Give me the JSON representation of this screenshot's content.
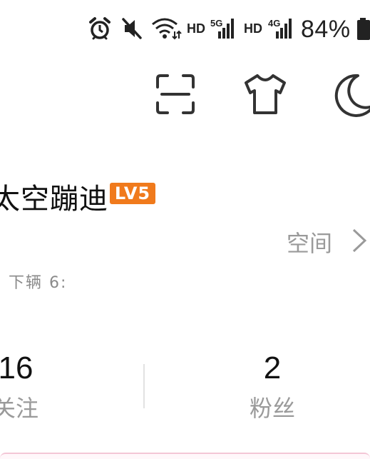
{
  "status_bar": {
    "icons": [
      "alarm-icon",
      "mute-icon",
      "wifi-icon",
      "signal-5g-icon",
      "signal-4g-icon",
      "battery-icon"
    ],
    "hd_label_1": "HD",
    "net_label_1": "5G",
    "hd_label_2": "HD",
    "net_label_2": "4G",
    "battery_percent": "84%"
  },
  "top_actions": {
    "icons": [
      "scan-icon",
      "theme-shirt-icon",
      "night-mode-icon"
    ]
  },
  "profile": {
    "name": "太空蹦迪",
    "level_badge": "LV5",
    "space_link_label": "空间",
    "subtitle": "下辆 6:"
  },
  "stats": {
    "following": {
      "value": "16",
      "label": "关注"
    },
    "fans": {
      "value": "2",
      "label": "粉丝"
    }
  },
  "colors": {
    "level_badge": "#f07a1c",
    "primary_text": "#111111",
    "secondary_text": "#9a9a9a",
    "icon_stroke": "#333333"
  }
}
